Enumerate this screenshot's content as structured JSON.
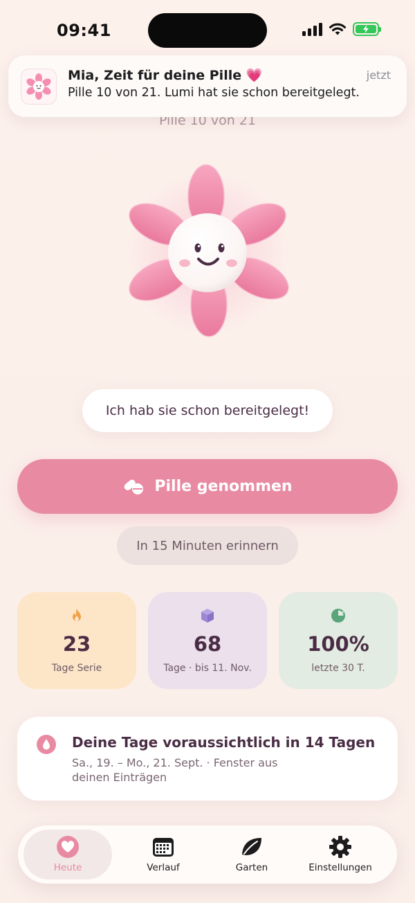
{
  "status_bar": {
    "time": "09:41"
  },
  "notification": {
    "title": "Mia, Zeit für deine Pille 💗",
    "body": "Pille 10 von 21. Lumi hat sie schon bereitgelegt.",
    "time": "jetzt"
  },
  "pill_counter": "Pille 10 von 21",
  "speech_bubble": "Ich hab sie schon bereitgelegt!",
  "primary_action": {
    "label": "Pille genommen"
  },
  "secondary_action": {
    "label": "In 15 Minuten erinnern"
  },
  "stats": [
    {
      "icon": "flame-icon",
      "value": "23",
      "label": "Tage Serie",
      "bg": "#fde6c8",
      "icon_color": "#f0a146"
    },
    {
      "icon": "box-icon",
      "value": "68",
      "label": "Tage · bis 11. Nov.",
      "bg": "#ebe0ec",
      "icon_color": "#9d87d4"
    },
    {
      "icon": "pie-chart-icon",
      "value": "100%",
      "label": "letzte 30 T.",
      "bg": "#e3ece2",
      "icon_color": "#5aa57a"
    }
  ],
  "period_card": {
    "title": "Deine Tage voraussichtlich in 14 Tagen",
    "subtitle": "Sa., 19. – Mo., 21. Sept. · Fenster aus deinen Einträgen"
  },
  "tabbar": {
    "items": [
      {
        "label": "Heute",
        "icon": "heart-icon",
        "active": true
      },
      {
        "label": "Verlauf",
        "icon": "calendar-icon",
        "active": false
      },
      {
        "label": "Garten",
        "icon": "leaf-icon",
        "active": false
      },
      {
        "label": "Einstellungen",
        "icon": "gear-icon",
        "active": false
      }
    ]
  },
  "colors": {
    "accent": "#e98aa3",
    "text": "#4a2d45",
    "background": "#fbefea"
  }
}
